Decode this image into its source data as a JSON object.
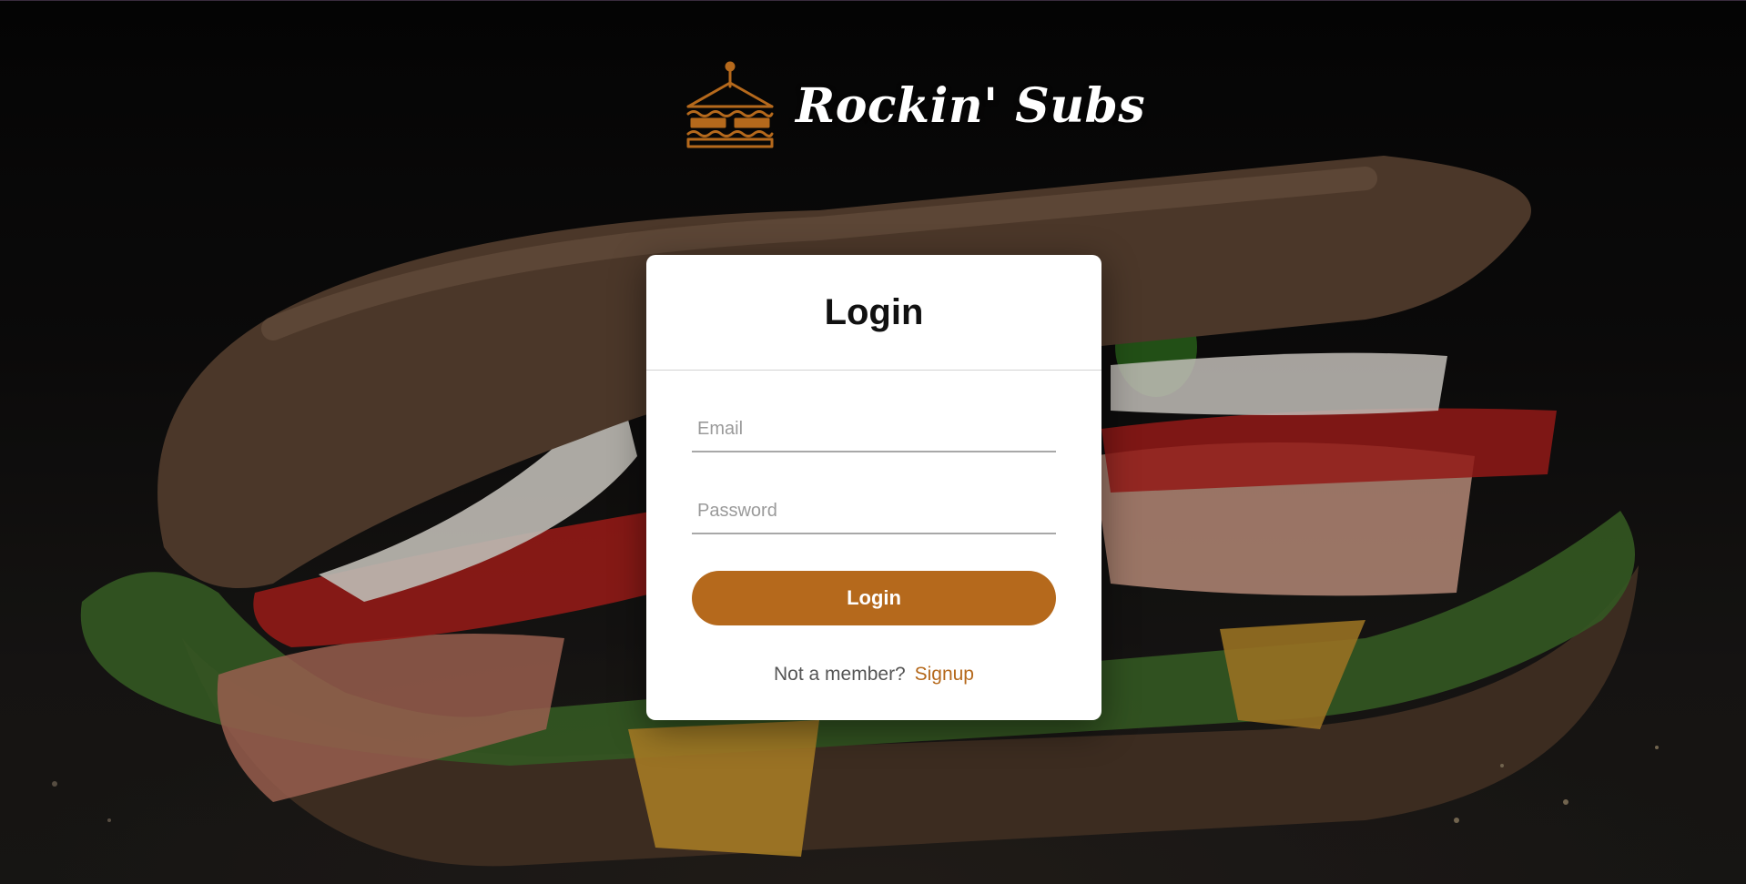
{
  "brand": {
    "name": "Rockin' Subs",
    "icon": "sandwich-icon",
    "accent": "#b5691c"
  },
  "login_card": {
    "title": "Login",
    "email": {
      "placeholder": "Email",
      "value": ""
    },
    "password": {
      "placeholder": "Password",
      "value": ""
    },
    "submit_label": "Login",
    "signup_prompt": "Not a member?",
    "signup_link": "Signup"
  },
  "colors": {
    "button": "#b5691c",
    "link": "#b5691c",
    "card": "#ffffff"
  }
}
